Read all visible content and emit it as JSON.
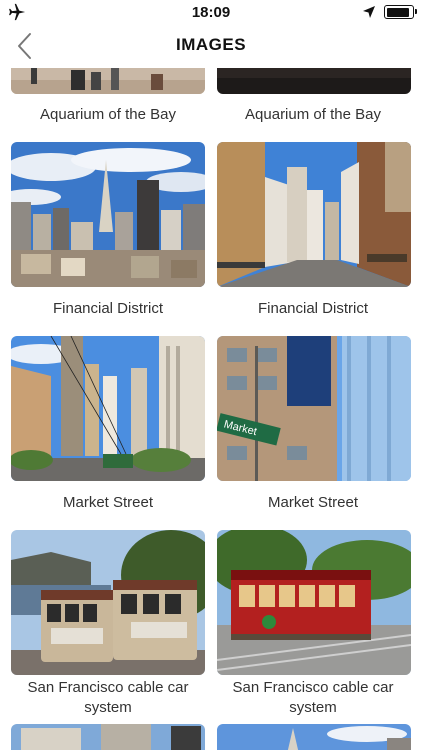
{
  "status": {
    "time": "18:09",
    "battery_level": 0.9
  },
  "nav": {
    "title": "IMAGES",
    "back_icon": "chevron-left-icon"
  },
  "items": [
    {
      "caption": "Aquarium of the Bay"
    },
    {
      "caption": "Aquarium of the Bay"
    },
    {
      "caption": "Financial District"
    },
    {
      "caption": "Financial District"
    },
    {
      "caption": "Market Street"
    },
    {
      "caption": "Market Street"
    },
    {
      "caption": "San Francisco cable car system"
    },
    {
      "caption": "San Francisco cable car system"
    }
  ],
  "signs": {
    "market": "Market"
  }
}
